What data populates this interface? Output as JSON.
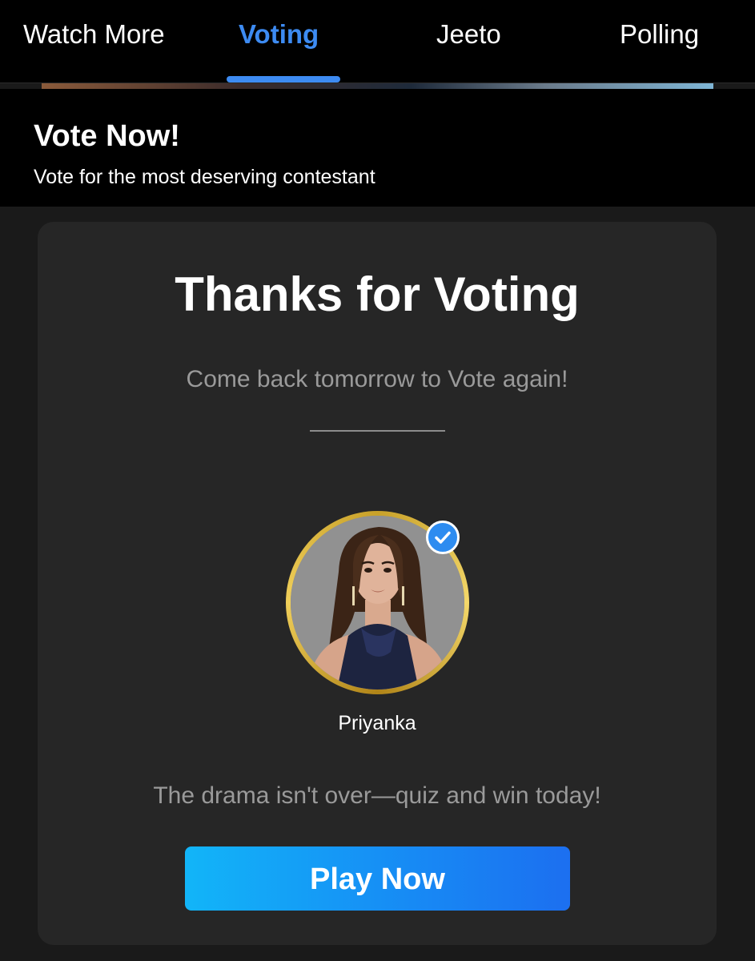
{
  "tabs": [
    {
      "label": "Watch More",
      "active": false
    },
    {
      "label": "Voting",
      "active": true
    },
    {
      "label": "Jeeto",
      "active": false
    },
    {
      "label": "Polling",
      "active": false
    }
  ],
  "header": {
    "title": "Vote Now!",
    "subtitle": "Vote for the most deserving contestant"
  },
  "card": {
    "title": "Thanks for Voting",
    "message": "Come back tomorrow to Vote again!",
    "contestant": {
      "name": "Priyanka",
      "verified_icon": "check-circle-icon"
    },
    "promo_text": "The drama isn't over—quiz and win today!",
    "cta_label": "Play Now"
  },
  "colors": {
    "accent": "#3d8bf2",
    "card_bg": "#262626",
    "muted_text": "#9a9a9a",
    "button_gradient_start": "#12b5f8",
    "button_gradient_end": "#1c6ff0",
    "avatar_ring": "#c8a12a"
  }
}
